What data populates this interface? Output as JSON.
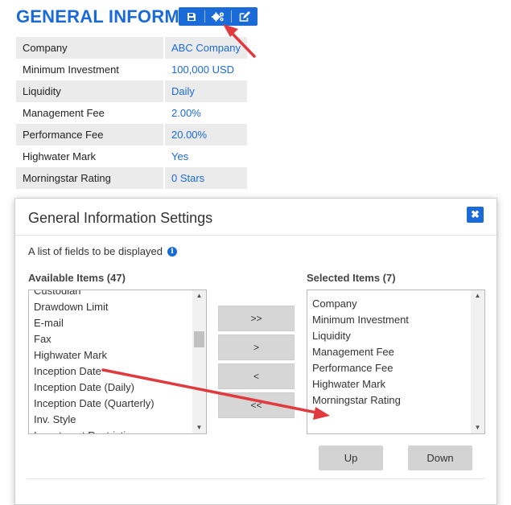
{
  "page": {
    "title": "GENERAL INFORMAT",
    "toolbar": {
      "icons": [
        "save-icon",
        "settings-gears-icon",
        "edit-icon"
      ]
    }
  },
  "info": {
    "rows": [
      {
        "label": "Company",
        "value": "ABC Company"
      },
      {
        "label": "Minimum Investment",
        "value": "100,000 USD"
      },
      {
        "label": "Liquidity",
        "value": "Daily"
      },
      {
        "label": "Management Fee",
        "value": "2.00%"
      },
      {
        "label": "Performance Fee",
        "value": "20.00%"
      },
      {
        "label": "Highwater Mark",
        "value": "Yes"
      },
      {
        "label": "Morningstar Rating",
        "value": "0 Stars"
      }
    ]
  },
  "dialog": {
    "title": "General Information Settings",
    "close_symbol": "✖",
    "description": "A list of fields to be displayed",
    "info_symbol": "i",
    "available": {
      "label": "Available Items (47)",
      "items": [
        "Custodian",
        "Drawdown Limit",
        "E-mail",
        "Fax",
        "Highwater Mark",
        "Inception Date",
        "Inception Date (Daily)",
        "Inception Date (Quarterly)",
        "Inv. Style",
        "Investment Restriction"
      ]
    },
    "selected": {
      "label": "Selected Items (7)",
      "items": [
        "Company",
        "Minimum Investment",
        "Liquidity",
        "Management Fee",
        "Performance Fee",
        "Highwater Mark",
        "Morningstar Rating"
      ]
    },
    "buttons": {
      "add_all": ">>",
      "add": ">",
      "remove": "<",
      "remove_all": "<<",
      "up": "Up",
      "down": "Down"
    }
  },
  "colors": {
    "accent": "#1a6ad8",
    "annotation_arrow": "#e0393e"
  }
}
